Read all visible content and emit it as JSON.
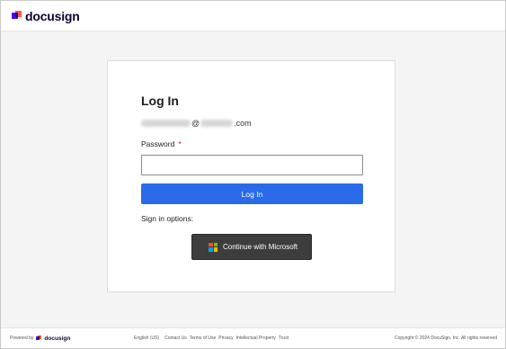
{
  "header": {
    "brand": "docusign"
  },
  "login": {
    "title": "Log In",
    "email_domain_suffix": "@",
    "email_tld": ".com",
    "password_label": "Password",
    "required_marker": "*",
    "password_value": "",
    "login_button": "Log In",
    "sign_in_options_label": "Sign in options:",
    "microsoft_button": "Continue with Microsoft"
  },
  "icons": {
    "brand_logo": "docusign-logo-icon",
    "microsoft": "microsoft-logo-icon"
  },
  "colors": {
    "primary_button": "#2a6bea",
    "microsoft_button": "#3d3d3d",
    "required": "#d4002f",
    "ms_red": "#f25022",
    "ms_green": "#7fba00",
    "ms_blue": "#00a4ef",
    "ms_yellow": "#ffb900"
  },
  "footer": {
    "powered_by": "Powered by",
    "brand": "docusign",
    "language": "English (US)",
    "links": [
      "Contact Us",
      "Terms of Use",
      "Privacy",
      "Intellectual Property",
      "Trust"
    ],
    "copyright": "Copyright © 2024 DocuSign, Inc. All rights reserved"
  }
}
